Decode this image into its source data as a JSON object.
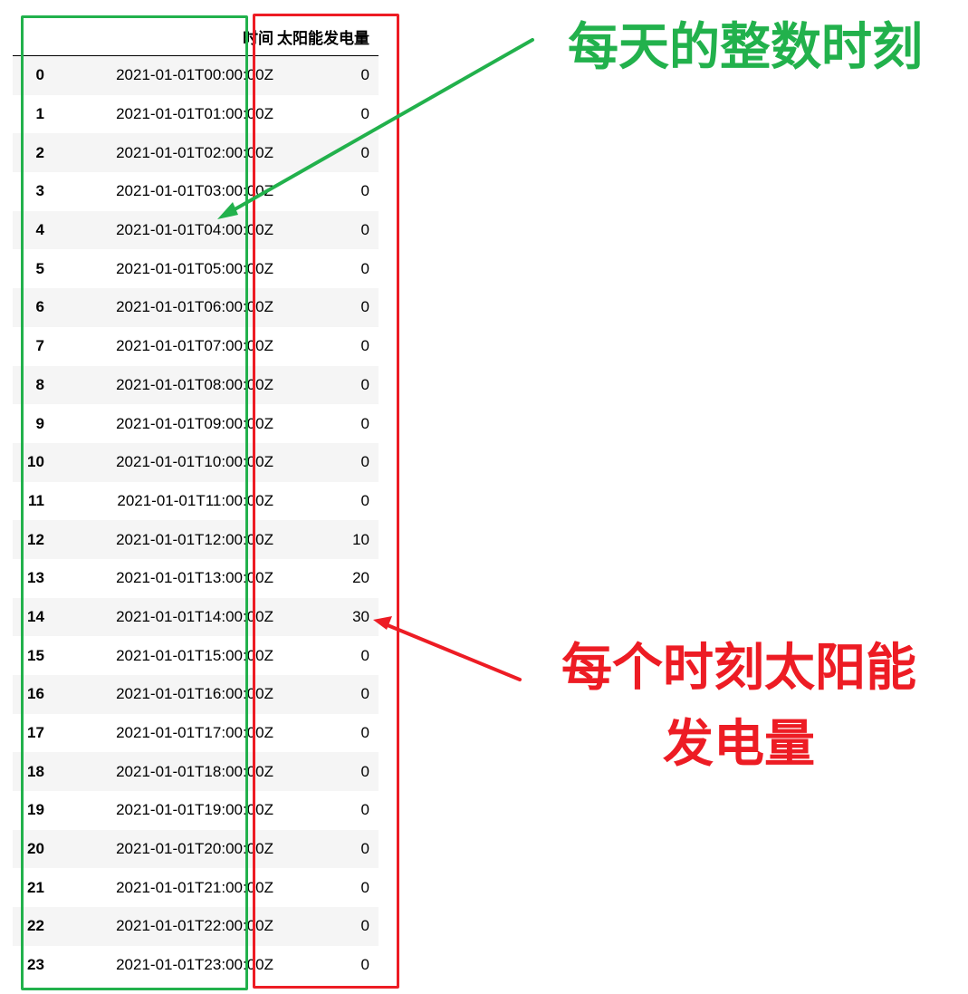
{
  "table": {
    "headers": {
      "index": "",
      "time": "时间",
      "power": "太阳能发电量"
    },
    "rows": [
      {
        "index": "0",
        "time": "2021-01-01T00:00:00Z",
        "power": "0"
      },
      {
        "index": "1",
        "time": "2021-01-01T01:00:00Z",
        "power": "0"
      },
      {
        "index": "2",
        "time": "2021-01-01T02:00:00Z",
        "power": "0"
      },
      {
        "index": "3",
        "time": "2021-01-01T03:00:00Z",
        "power": "0"
      },
      {
        "index": "4",
        "time": "2021-01-01T04:00:00Z",
        "power": "0"
      },
      {
        "index": "5",
        "time": "2021-01-01T05:00:00Z",
        "power": "0"
      },
      {
        "index": "6",
        "time": "2021-01-01T06:00:00Z",
        "power": "0"
      },
      {
        "index": "7",
        "time": "2021-01-01T07:00:00Z",
        "power": "0"
      },
      {
        "index": "8",
        "time": "2021-01-01T08:00:00Z",
        "power": "0"
      },
      {
        "index": "9",
        "time": "2021-01-01T09:00:00Z",
        "power": "0"
      },
      {
        "index": "10",
        "time": "2021-01-01T10:00:00Z",
        "power": "0"
      },
      {
        "index": "11",
        "time": "2021-01-01T11:00:00Z",
        "power": "0"
      },
      {
        "index": "12",
        "time": "2021-01-01T12:00:00Z",
        "power": "10"
      },
      {
        "index": "13",
        "time": "2021-01-01T13:00:00Z",
        "power": "20"
      },
      {
        "index": "14",
        "time": "2021-01-01T14:00:00Z",
        "power": "30"
      },
      {
        "index": "15",
        "time": "2021-01-01T15:00:00Z",
        "power": "0"
      },
      {
        "index": "16",
        "time": "2021-01-01T16:00:00Z",
        "power": "0"
      },
      {
        "index": "17",
        "time": "2021-01-01T17:00:00Z",
        "power": "0"
      },
      {
        "index": "18",
        "time": "2021-01-01T18:00:00Z",
        "power": "0"
      },
      {
        "index": "19",
        "time": "2021-01-01T19:00:00Z",
        "power": "0"
      },
      {
        "index": "20",
        "time": "2021-01-01T20:00:00Z",
        "power": "0"
      },
      {
        "index": "21",
        "time": "2021-01-01T21:00:00Z",
        "power": "0"
      },
      {
        "index": "22",
        "time": "2021-01-01T22:00:00Z",
        "power": "0"
      },
      {
        "index": "23",
        "time": "2021-01-01T23:00:00Z",
        "power": "0"
      }
    ]
  },
  "annotations": {
    "time_callout": "每天的整数时刻",
    "power_callout_line1": "每个时刻太阳能",
    "power_callout_line2": "发电量"
  },
  "colors": {
    "green": "#22b14c",
    "red": "#ed1c24",
    "row_stripe": "#f5f5f5"
  }
}
